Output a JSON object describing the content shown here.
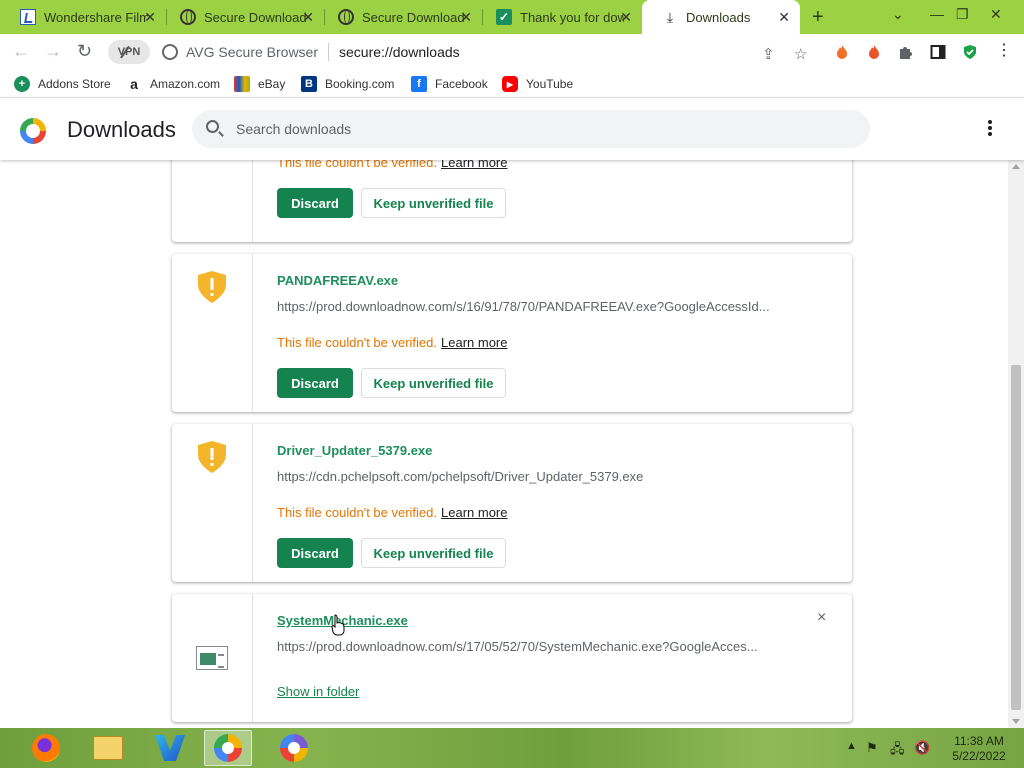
{
  "tabs": [
    {
      "title": "Wondershare Filmora",
      "icon": "wondershare-icon",
      "active": false
    },
    {
      "title": "Secure Download",
      "icon": "globe-icon",
      "active": false
    },
    {
      "title": "Secure Download",
      "icon": "globe-icon",
      "active": false
    },
    {
      "title": "Thank you for downloading",
      "icon": "check-icon",
      "active": false
    },
    {
      "title": "Downloads",
      "icon": "download-icon",
      "active": true
    }
  ],
  "omnibox": {
    "vpn_label": "VPN",
    "brand": "AVG Secure Browser",
    "url": "secure://downloads"
  },
  "bookmarks": [
    {
      "label": "Addons Store",
      "icon": "addons-store-icon",
      "color": "#1a8f5c"
    },
    {
      "label": "Amazon.com",
      "icon": "amazon-icon",
      "color": "#222222"
    },
    {
      "label": "eBay",
      "icon": "ebay-icon",
      "color": "#e53238"
    },
    {
      "label": "Booking.com",
      "icon": "booking-icon",
      "color": "#003580"
    },
    {
      "label": "Facebook",
      "icon": "facebook-icon",
      "color": "#1877f2"
    },
    {
      "label": "YouTube",
      "icon": "youtube-icon",
      "color": "#ff0000"
    }
  ],
  "header": {
    "title": "Downloads",
    "search_placeholder": "Search downloads"
  },
  "downloads": [
    {
      "filename": "",
      "url": "",
      "warning": "This file couldn't be verified.",
      "learn_more": "Learn more",
      "discard": "Discard",
      "keep": "Keep unverified file"
    },
    {
      "filename": "PANDAFREEAV.exe",
      "url": "https://prod.downloadnow.com/s/16/91/78/70/PANDAFREEAV.exe?GoogleAccessId...",
      "warning": "This file couldn't be verified.",
      "learn_more": "Learn more",
      "discard": "Discard",
      "keep": "Keep unverified file"
    },
    {
      "filename": "Driver_Updater_5379.exe",
      "url": "https://cdn.pchelpsoft.com/pchelpsoft/Driver_Updater_5379.exe",
      "warning": "This file couldn't be verified.",
      "learn_more": "Learn more",
      "discard": "Discard",
      "keep": "Keep unverified file"
    },
    {
      "filename": "SystemMechanic.exe",
      "url": "https://prod.downloadnow.com/s/17/05/52/70/SystemMechanic.exe?GoogleAcces...",
      "show_in_folder": "Show in folder",
      "close": "×"
    }
  ],
  "colors": {
    "tab_strip": "#9cd144",
    "accent_green": "#14834f",
    "warning_orange": "#e37400",
    "shield_yellow": "#f5b52b"
  },
  "taskbar": {
    "apps": [
      "firefox-icon",
      "file-explorer-icon",
      "wondershare-filmora-icon",
      "avg-browser-icon",
      "avg-browser-alt-icon"
    ],
    "clock_time": "11:38 AM",
    "clock_date": "5/22/2022"
  }
}
